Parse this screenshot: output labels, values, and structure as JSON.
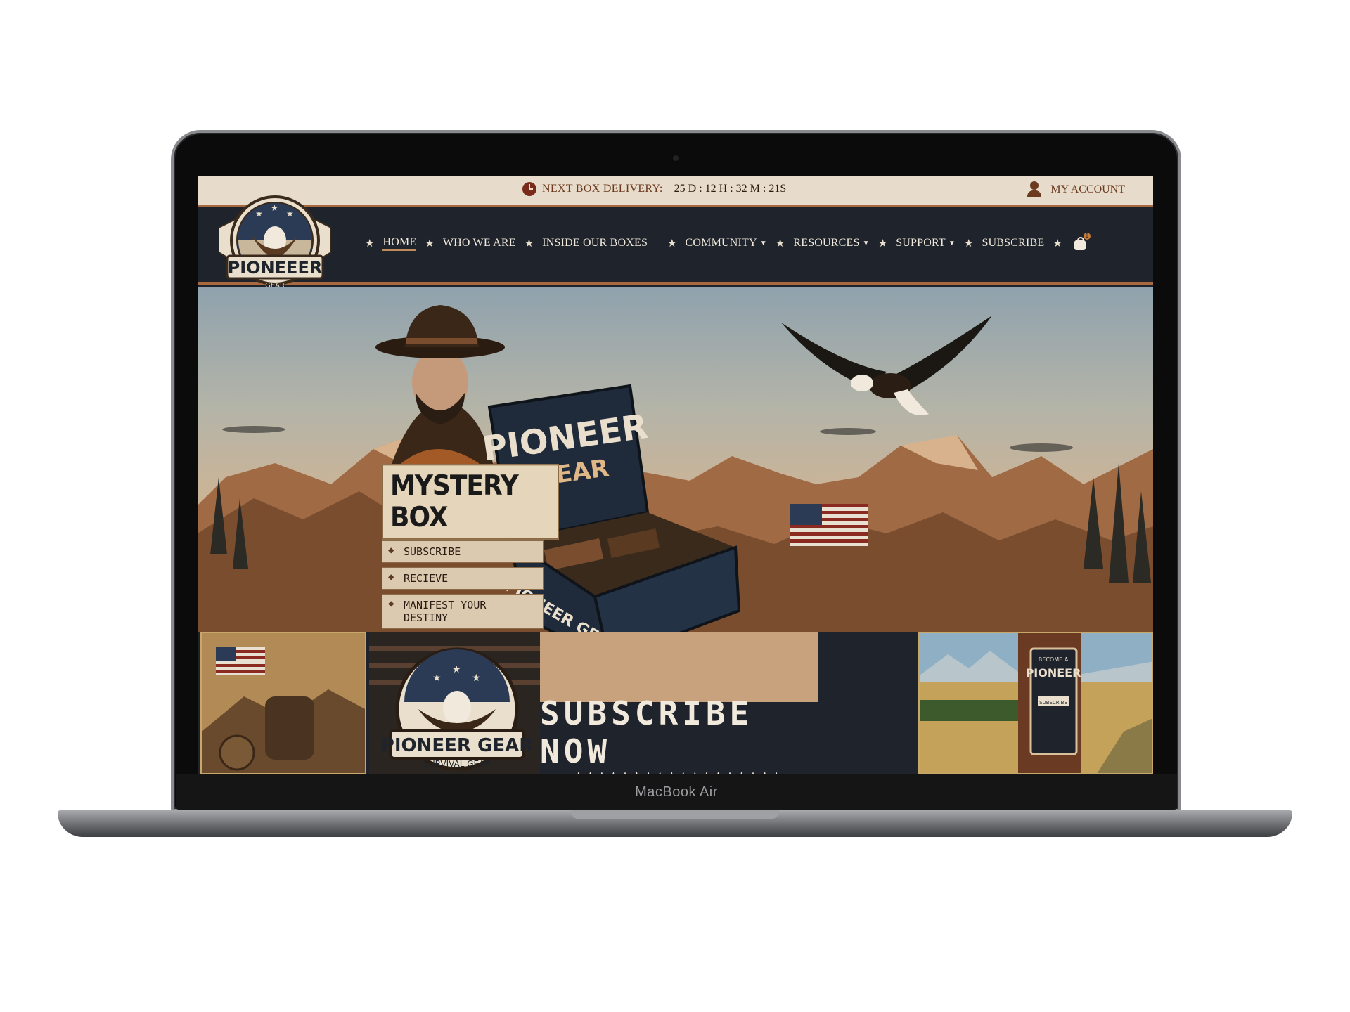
{
  "device": {
    "chin_label": "MacBook Air"
  },
  "topbar": {
    "delivery_label": "NEXT BOX DELIVERY:",
    "countdown": "25 D : 12 H : 32 M : 21S",
    "account_label": "MY ACCOUNT"
  },
  "nav": {
    "items": [
      {
        "label": "HOME"
      },
      {
        "label": "WHO WE ARE"
      },
      {
        "label": "INSIDE OUR BOXES"
      },
      {
        "label": "COMMUNITY"
      },
      {
        "label": "RESOURCES"
      },
      {
        "label": "SUPPORT"
      },
      {
        "label": "SUBSCRIBE"
      }
    ],
    "cart_count": "1"
  },
  "logo": {
    "text": "PIONEEER",
    "sub": "GEAR"
  },
  "hero": {
    "sign_title": "MYSTERY BOX",
    "steps": [
      "SUBSCRIBE",
      "RECIEVE",
      "MANIFEST YOUR DESTINY"
    ],
    "box_title": "PIONEER",
    "box_sub": "GEAR",
    "box_front": "PIONEER GEAR"
  },
  "strip": {
    "badge_text": "PIONEER GEAR",
    "badge_sub": "GEAR",
    "badge_ring": "SURVIVAL GEAR",
    "subscribe": "SUBSCRIBE NOW",
    "stars": "★★★★★★★★★★★★★★★★★★",
    "poster_top": "BECOME A",
    "poster_title": "PIONEER",
    "poster_btn": "SUBSCRIBE"
  },
  "colors": {
    "accent": "#a7693d",
    "nav_bg": "#1f242c",
    "topbar_bg": "#e7dccb"
  }
}
